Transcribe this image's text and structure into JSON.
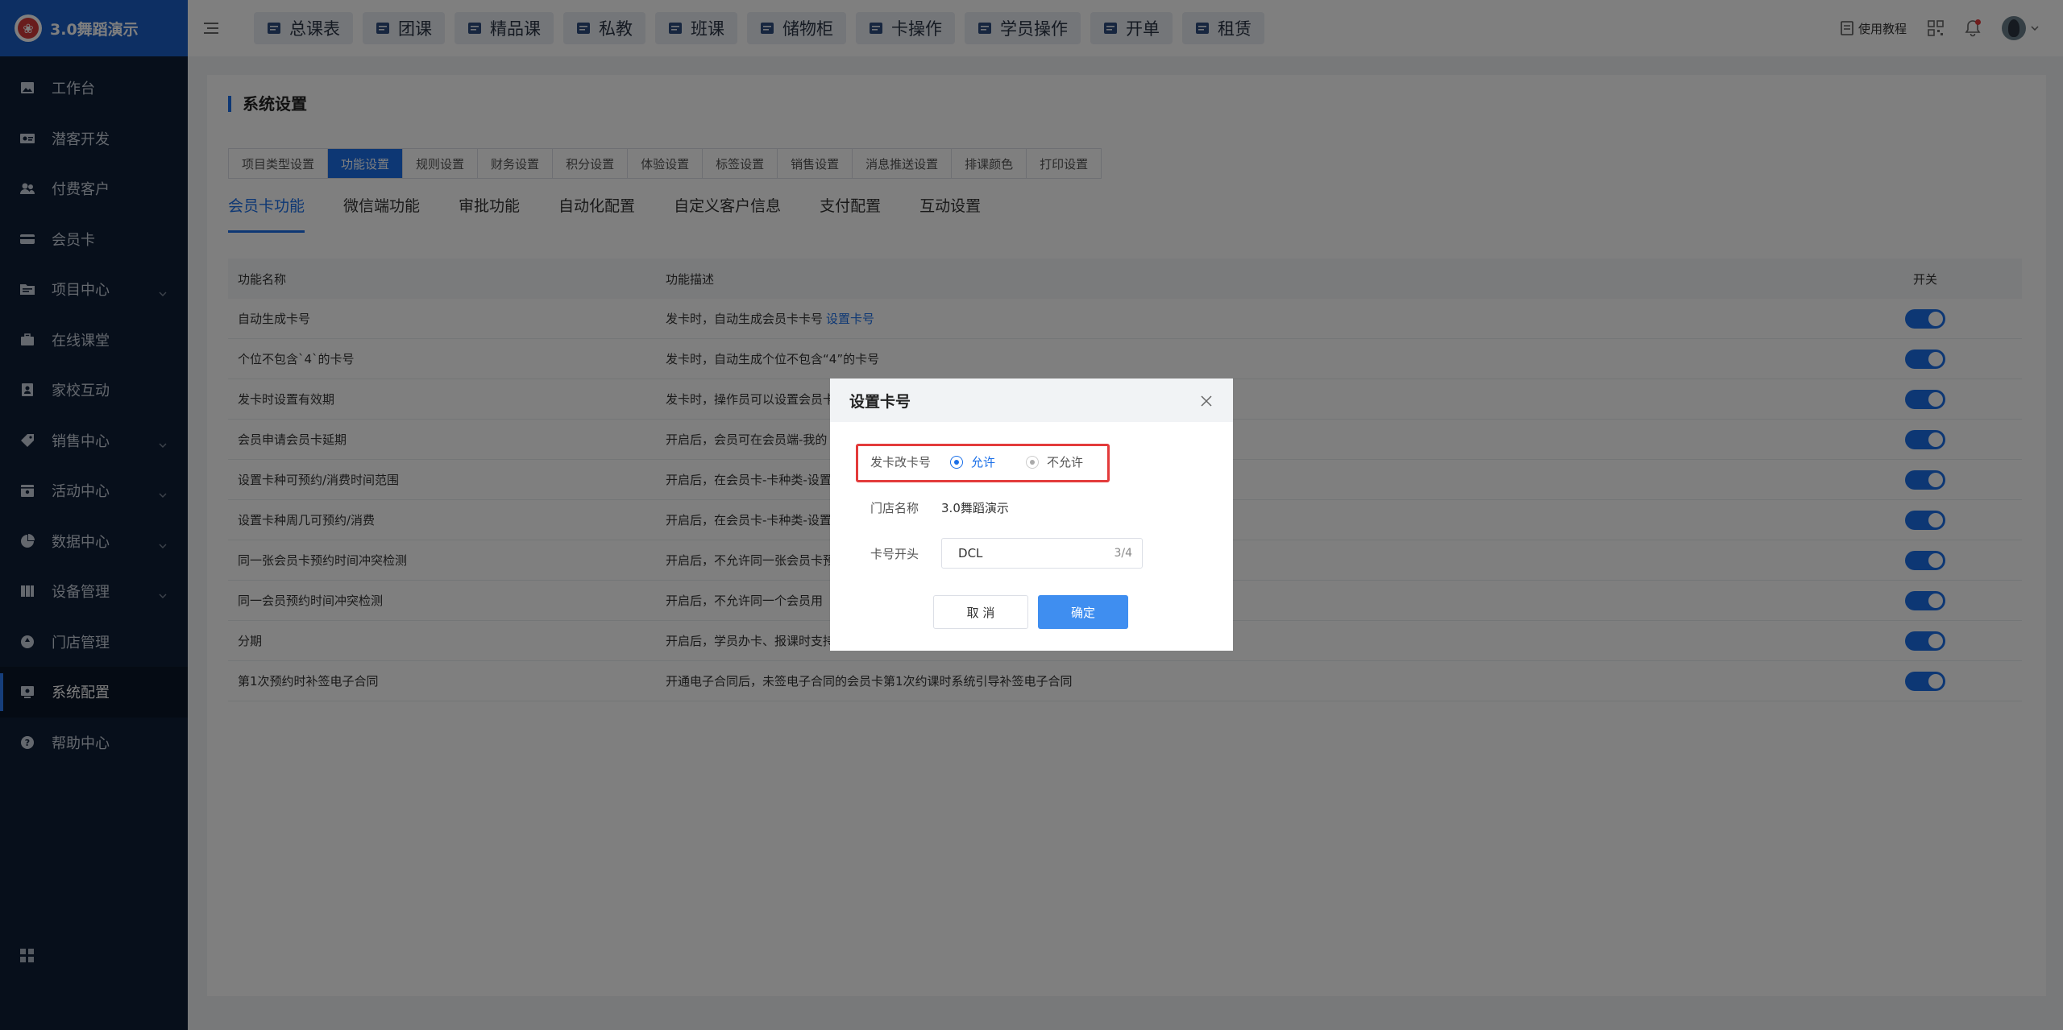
{
  "app": {
    "name": "3.0舞蹈演示",
    "logo_glyph": "❀"
  },
  "sidebar": {
    "items": [
      {
        "label": "工作台",
        "icon": "image-icon",
        "has_children": false,
        "active": false
      },
      {
        "label": "潜客开发",
        "icon": "id-card-icon",
        "has_children": false,
        "active": false
      },
      {
        "label": "付费客户",
        "icon": "users-icon",
        "has_children": false,
        "active": false
      },
      {
        "label": "会员卡",
        "icon": "card-icon",
        "has_children": false,
        "active": false
      },
      {
        "label": "项目中心",
        "icon": "folder-icon",
        "has_children": true,
        "active": false
      },
      {
        "label": "在线课堂",
        "icon": "briefcase-icon",
        "has_children": false,
        "active": false
      },
      {
        "label": "家校互动",
        "icon": "contact-book-icon",
        "has_children": false,
        "active": false
      },
      {
        "label": "销售中心",
        "icon": "tag-icon",
        "has_children": true,
        "active": false
      },
      {
        "label": "活动中心",
        "icon": "calendar-icon",
        "has_children": true,
        "active": false
      },
      {
        "label": "数据中心",
        "icon": "pie-chart-icon",
        "has_children": true,
        "active": false
      },
      {
        "label": "设备管理",
        "icon": "device-icon",
        "has_children": true,
        "active": false
      },
      {
        "label": "门店管理",
        "icon": "store-icon",
        "has_children": false,
        "active": false
      },
      {
        "label": "系统配置",
        "icon": "settings-icon",
        "has_children": false,
        "active": true
      },
      {
        "label": "帮助中心",
        "icon": "help-icon",
        "has_children": false,
        "active": false
      }
    ]
  },
  "topbar": {
    "quick_links": [
      {
        "label": "总课表",
        "icon": "schedule-icon"
      },
      {
        "label": "团课",
        "icon": "book-icon"
      },
      {
        "label": "精品课",
        "icon": "premium-course-icon"
      },
      {
        "label": "私教",
        "icon": "private-coach-icon"
      },
      {
        "label": "班课",
        "icon": "class-icon"
      },
      {
        "label": "储物柜",
        "icon": "locker-icon"
      },
      {
        "label": "卡操作",
        "icon": "card-op-icon"
      },
      {
        "label": "学员操作",
        "icon": "student-icon"
      },
      {
        "label": "开单",
        "icon": "order-icon"
      },
      {
        "label": "租赁",
        "icon": "lease-icon"
      }
    ],
    "tutorial": "使用教程"
  },
  "page": {
    "title": "系统设置",
    "settings_tabs": [
      "项目类型设置",
      "功能设置",
      "规则设置",
      "财务设置",
      "积分设置",
      "体验设置",
      "标签设置",
      "销售设置",
      "消息推送设置",
      "排课颜色",
      "打印设置"
    ],
    "settings_tab_active": 1,
    "sub_tabs": [
      "会员卡功能",
      "微信端功能",
      "审批功能",
      "自动化配置",
      "自定义客户信息",
      "支付配置",
      "互动设置"
    ],
    "sub_tab_active": 0,
    "table": {
      "headers": [
        "功能名称",
        "功能描述",
        "开关"
      ],
      "rows": [
        {
          "name": "自动生成卡号",
          "desc": "发卡时，自动生成会员卡卡号",
          "link": "设置卡号",
          "on": true
        },
        {
          "name": "个位不包含`4`的卡号",
          "desc": "发卡时，自动生成个位不包含“4”的卡号",
          "link": "",
          "on": true
        },
        {
          "name": "发卡时设置有效期",
          "desc": "发卡时，操作员可以设置会员卡",
          "link": "",
          "on": true
        },
        {
          "name": "会员申请会员卡延期",
          "desc": "开启后，会员可在会员端-我的",
          "link": "",
          "on": true
        },
        {
          "name": "设置卡种可预约/消费时间范围",
          "desc": "开启后，在会员卡-卡种类-设置",
          "link": "",
          "on": true
        },
        {
          "name": "设置卡种周几可预约/消费",
          "desc": "开启后，在会员卡-卡种类-设置",
          "link": "",
          "on": true
        },
        {
          "name": "同一张会员卡预约时间冲突检测",
          "desc": "开启后，不允许同一张会员卡预",
          "link": "",
          "on": true
        },
        {
          "name": "同一会员预约时间冲突检测",
          "desc": "开启后，不允许同一个会员用",
          "link": "",
          "on": true
        },
        {
          "name": "分期",
          "desc": "开启后，学员办卡、报课时支持",
          "link": "",
          "on": true
        },
        {
          "name": "第1次预约时补签电子合同",
          "desc": "开通电子合同后，未签电子合同的会员卡第1次约课时系统引导补签电子合同",
          "link": "",
          "on": true
        }
      ]
    }
  },
  "modal": {
    "title": "设置卡号",
    "allow_edit": {
      "label": "发卡改卡号",
      "options": [
        "允许",
        "不允许"
      ],
      "selected": 0
    },
    "store": {
      "label": "门店名称",
      "value": "3.0舞蹈演示"
    },
    "prefix": {
      "label": "卡号开头",
      "value": "DCL",
      "count": "3/4"
    },
    "cancel_label": "取 消",
    "ok_label": "确定"
  },
  "colors": {
    "accent": "#1a6fe8",
    "sidebar_bg": "#0f1e36",
    "highlight": "#e33b3b"
  }
}
